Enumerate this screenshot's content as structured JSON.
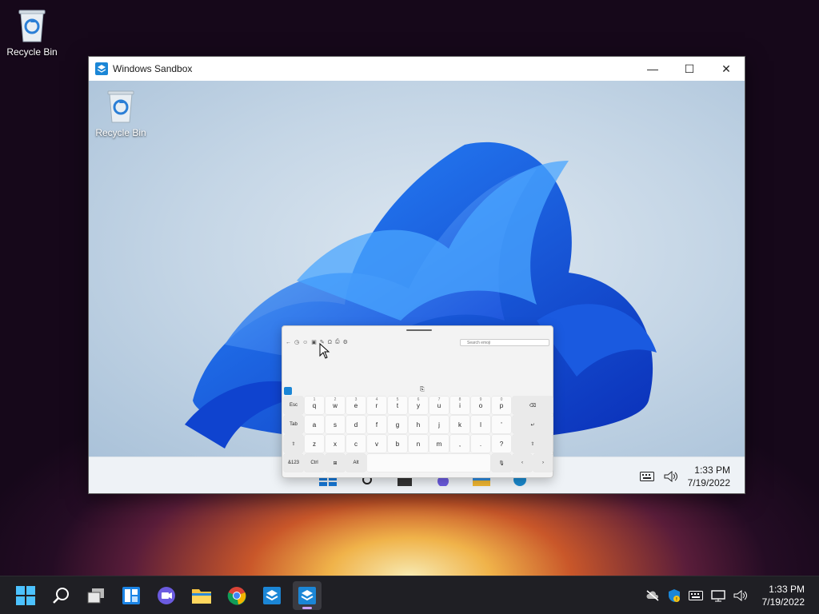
{
  "desktop": {
    "recycle_bin_label": "Recycle Bin"
  },
  "window": {
    "title": "Windows Sandbox",
    "minimize_glyph": "—",
    "maximize_glyph": "☐",
    "close_glyph": "✕"
  },
  "sandbox": {
    "recycle_bin_label": "Recycle Bin",
    "clock": {
      "time": "1:33 PM",
      "date": "7/19/2022"
    }
  },
  "keyboard": {
    "search_placeholder": "Search emoji",
    "row1": [
      {
        "label": "Esc",
        "sub": ""
      },
      {
        "label": "q",
        "sub": "1"
      },
      {
        "label": "w",
        "sub": "2"
      },
      {
        "label": "e",
        "sub": "3"
      },
      {
        "label": "r",
        "sub": "4"
      },
      {
        "label": "t",
        "sub": "5"
      },
      {
        "label": "y",
        "sub": "6"
      },
      {
        "label": "u",
        "sub": "7"
      },
      {
        "label": "i",
        "sub": "8"
      },
      {
        "label": "o",
        "sub": "9"
      },
      {
        "label": "p",
        "sub": "0"
      },
      {
        "label": "⌫",
        "sub": ""
      }
    ],
    "row2": [
      {
        "label": "Tab",
        "sub": ""
      },
      {
        "label": "a",
        "sub": ""
      },
      {
        "label": "s",
        "sub": ""
      },
      {
        "label": "d",
        "sub": ""
      },
      {
        "label": "f",
        "sub": ""
      },
      {
        "label": "g",
        "sub": ""
      },
      {
        "label": "h",
        "sub": ""
      },
      {
        "label": "j",
        "sub": ""
      },
      {
        "label": "k",
        "sub": ""
      },
      {
        "label": "l",
        "sub": ""
      },
      {
        "label": "'",
        "sub": ""
      },
      {
        "label": "↵",
        "sub": ""
      }
    ],
    "row3": [
      {
        "label": "⇧",
        "sub": ""
      },
      {
        "label": "z",
        "sub": ""
      },
      {
        "label": "x",
        "sub": ""
      },
      {
        "label": "c",
        "sub": ""
      },
      {
        "label": "v",
        "sub": ""
      },
      {
        "label": "b",
        "sub": ""
      },
      {
        "label": "n",
        "sub": ""
      },
      {
        "label": "m",
        "sub": ""
      },
      {
        "label": ",",
        "sub": ""
      },
      {
        "label": ".",
        "sub": ""
      },
      {
        "label": "?",
        "sub": ""
      },
      {
        "label": "⇧",
        "sub": ""
      }
    ],
    "row4": [
      {
        "label": "&123",
        "sub": ""
      },
      {
        "label": "Ctrl",
        "sub": ""
      },
      {
        "label": "⊞",
        "sub": ""
      },
      {
        "label": "Alt",
        "sub": ""
      },
      {
        "label": "",
        "sub": ""
      },
      {
        "label": "🎙",
        "sub": ""
      },
      {
        "label": "‹",
        "sub": ""
      },
      {
        "label": "›",
        "sub": ""
      }
    ]
  },
  "taskbar": {
    "clock": {
      "time": "1:33 PM",
      "date": "7/19/2022"
    }
  },
  "colors": {
    "accent": "#0067c0",
    "windows_blue": "#0078d4"
  }
}
